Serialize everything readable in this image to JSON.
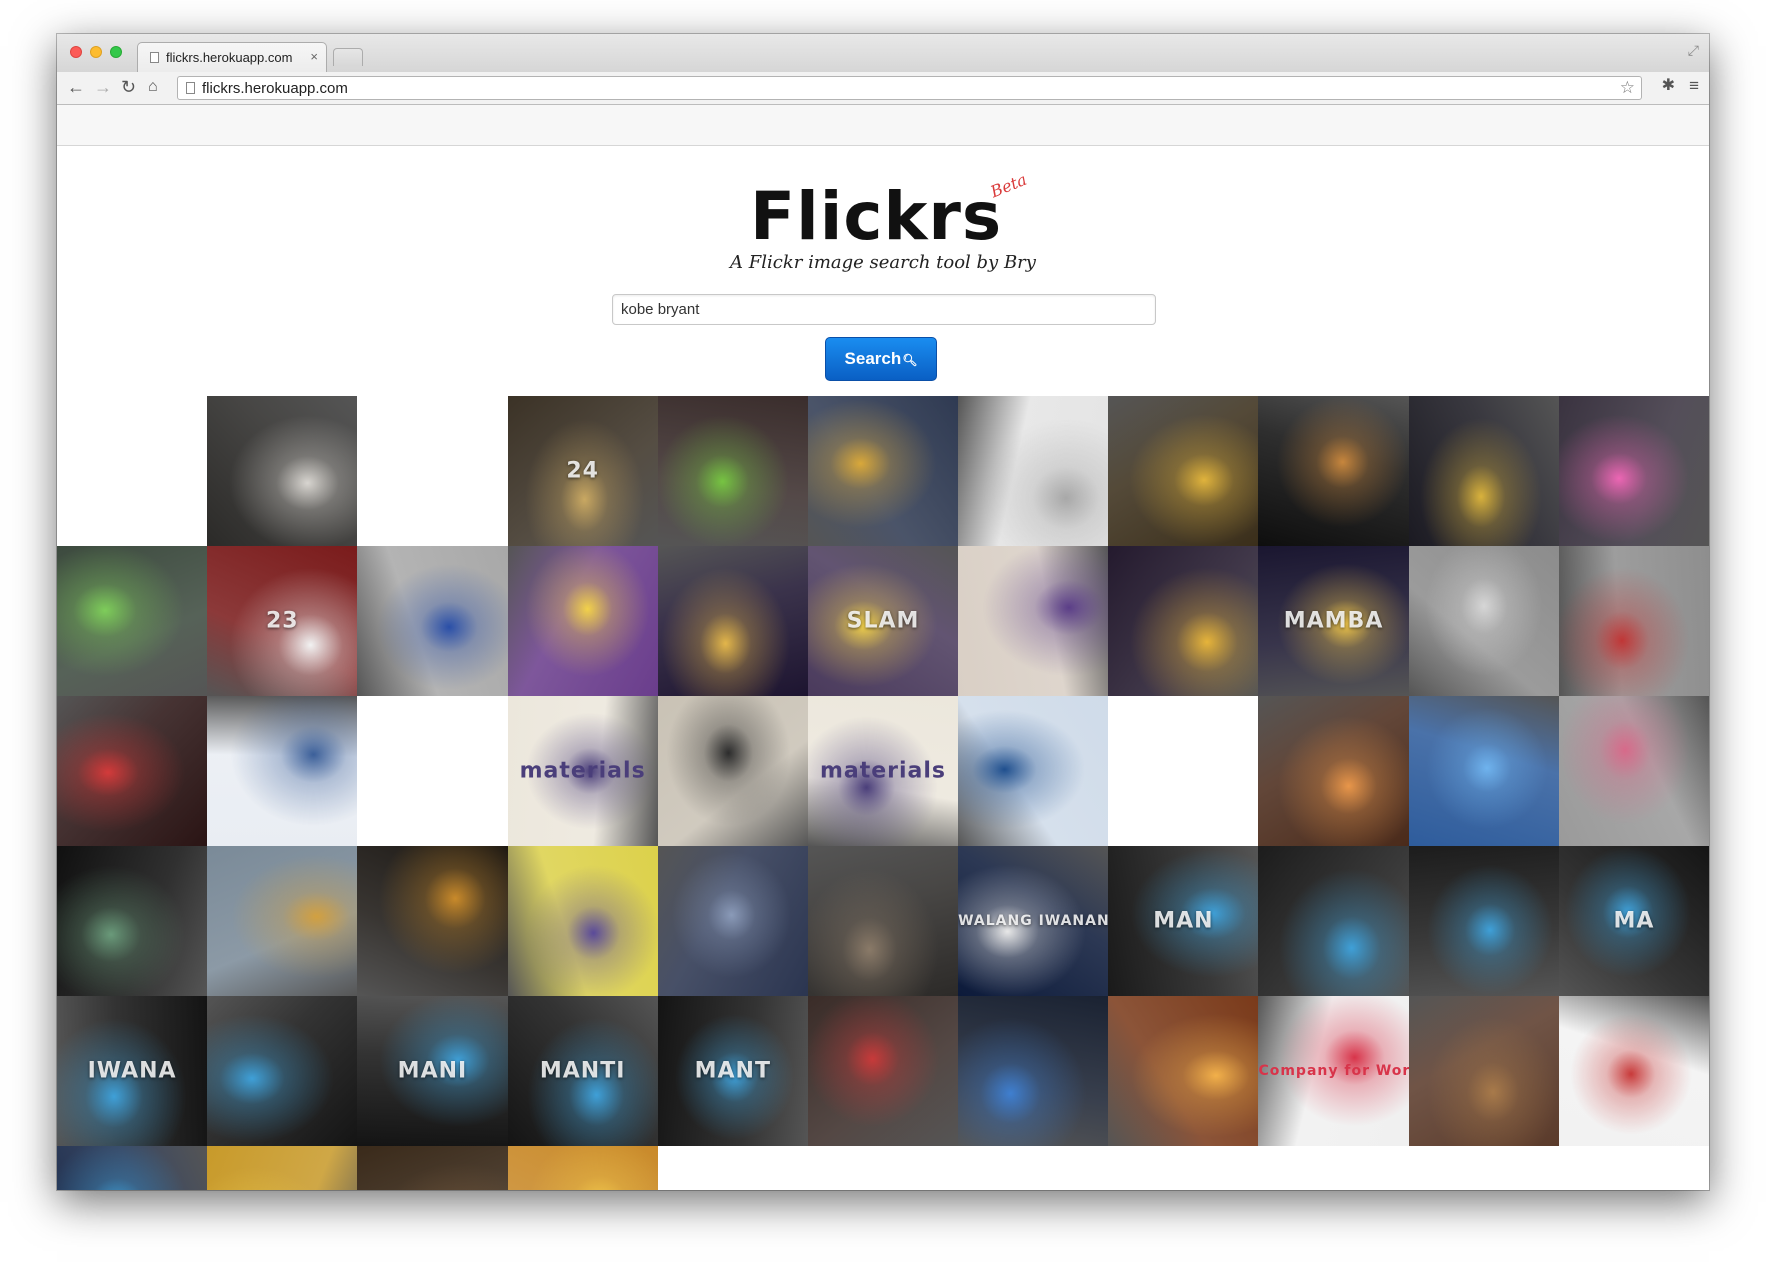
{
  "browser": {
    "tab_title": "flickrs.herokuapp.com",
    "tab_close": "×",
    "url": "flickrs.herokuapp.com",
    "icons": {
      "back": "back-arrow-icon",
      "forward": "forward-arrow-icon",
      "reload": "reload-icon",
      "home": "home-icon",
      "star": "star-icon",
      "extension": "extension-icon",
      "menu": "menu-icon"
    }
  },
  "app": {
    "logo": "Flickrs",
    "badge": "Beta",
    "tagline": "A Flickr image search tool by Bry",
    "search_value": "kobe bryant",
    "search_button": "Search"
  },
  "results": {
    "columns": 11,
    "tiles": [
      {
        "bg": "#f4f4f4",
        "fg": "#ddd",
        "text": ""
      },
      {
        "bg": "#2b2a28",
        "fg": "#d8d5d0",
        "text": ""
      },
      {
        "bg": "#f4f4f4",
        "fg": "#ddd",
        "text": ""
      },
      {
        "bg": "#3b3226",
        "fg": "#c9a862",
        "text": "24"
      },
      {
        "bg": "#3a2d2c",
        "fg": "#76c442",
        "text": ""
      },
      {
        "bg": "#2f3a52",
        "fg": "#d9a83a",
        "text": ""
      },
      {
        "bg": "#e4e4e4",
        "fg": "#a8a8a8",
        "text": ""
      },
      {
        "bg": "#3a2e1a",
        "fg": "#e0b33c",
        "text": ""
      },
      {
        "bg": "#0e0e0e",
        "fg": "#c7863d",
        "text": ""
      },
      {
        "bg": "#1b1a22",
        "fg": "#d9b23c",
        "text": ""
      },
      {
        "bg": "#3a3340",
        "fg": "#ec66b4",
        "text": ""
      },
      {
        "bg": "#3c4a3e",
        "fg": "#7ecd5a",
        "text": ""
      },
      {
        "bg": "#7a1b1b",
        "fg": "#f2f2f2",
        "text": "23"
      },
      {
        "bg": "#a8a8a8",
        "fg": "#2a4fa8",
        "text": ""
      },
      {
        "bg": "#6a3d8c",
        "fg": "#f2d14a",
        "text": ""
      },
      {
        "bg": "#1d1430",
        "fg": "#e3b64a",
        "text": ""
      },
      {
        "bg": "#4a3a5c",
        "fg": "#f2d14a",
        "text": "SLAM"
      },
      {
        "bg": "#d9cfc5",
        "fg": "#5b3e88",
        "text": ""
      },
      {
        "bg": "#241a2e",
        "fg": "#e6b43a",
        "text": ""
      },
      {
        "bg": "#1a1630",
        "fg": "#f2c84a",
        "text": "MAMBA"
      },
      {
        "bg": "#8c8c8c",
        "fg": "#d6d6d6",
        "text": ""
      },
      {
        "bg": "#8e8e8e",
        "fg": "#c03636",
        "text": ""
      },
      {
        "bg": "#2a1414",
        "fg": "#d33a3a",
        "text": ""
      },
      {
        "bg": "#e9edf3",
        "fg": "#3b5f99",
        "text": ""
      },
      {
        "bg": "#f5f5f5",
        "fg": "#333",
        "text": ""
      },
      {
        "bg": "#ece7dc",
        "fg": "#4a3e7a",
        "text": "materials"
      },
      {
        "bg": "#c9c2b5",
        "fg": "#2c2c2c",
        "text": ""
      },
      {
        "bg": "#ece7dc",
        "fg": "#4a3e7a",
        "text": "materials"
      },
      {
        "bg": "#cfdbe9",
        "fg": "#1f4f8e",
        "text": ""
      },
      {
        "bg": "#f2f2f2",
        "fg": "#555",
        "text": ""
      },
      {
        "bg": "#4a2a1a",
        "fg": "#e8964a",
        "text": ""
      },
      {
        "bg": "#2e5c9c",
        "fg": "#6fb3ee",
        "text": ""
      },
      {
        "bg": "#9a9a9a",
        "fg": "#d76a8a",
        "text": ""
      },
      {
        "bg": "#101010",
        "fg": "#6a9a7a",
        "text": ""
      },
      {
        "bg": "#7a8a98",
        "fg": "#d2a040",
        "text": ""
      },
      {
        "bg": "#1a1612",
        "fg": "#c98a2a",
        "text": ""
      },
      {
        "bg": "#dcd14a",
        "fg": "#5a4a9a",
        "text": ""
      },
      {
        "bg": "#2b3550",
        "fg": "#8a9ab8",
        "text": ""
      },
      {
        "bg": "#2c2a28",
        "fg": "#8a7a68",
        "text": ""
      },
      {
        "bg": "#0c1a3a",
        "fg": "#e8e8e8",
        "text": "WALANG IWANAN"
      },
      {
        "bg": "#1a1a1a",
        "fg": "#3fa0d8",
        "text": "MAN"
      },
      {
        "bg": "#1c1c1c",
        "fg": "#3fa0d8",
        "text": ""
      },
      {
        "bg": "#1c1c1c",
        "fg": "#3fa0d8",
        "text": ""
      },
      {
        "bg": "#151515",
        "fg": "#3fa0d8",
        "text": "MA"
      },
      {
        "bg": "#141414",
        "fg": "#3fa0d8",
        "text": "IWANA"
      },
      {
        "bg": "#141414",
        "fg": "#3fa0d8",
        "text": ""
      },
      {
        "bg": "#141414",
        "fg": "#3fa0d8",
        "text": "MANI"
      },
      {
        "bg": "#141414",
        "fg": "#3fa0d8",
        "text": "MANTI"
      },
      {
        "bg": "#141414",
        "fg": "#3fa0d8",
        "text": "MANT"
      },
      {
        "bg": "#3a2c28",
        "fg": "#c83a3a",
        "text": ""
      },
      {
        "bg": "#1a2232",
        "fg": "#3f7fd0",
        "text": ""
      },
      {
        "bg": "#7a3a1a",
        "fg": "#f2b04a",
        "text": ""
      },
      {
        "bg": "#f0f0f0",
        "fg": "#d8344a",
        "text": "Company for World"
      },
      {
        "bg": "#5a3a2a",
        "fg": "#a87a4a",
        "text": ""
      },
      {
        "bg": "#f2f2f2",
        "fg": "#c83a3a",
        "text": ""
      },
      {
        "bg": "#1a2a4a",
        "fg": "#3fa0d8",
        "text": ""
      },
      {
        "bg": "#c89a2a",
        "fg": "#f2d14a",
        "text": ""
      },
      {
        "bg": "#3a2a1a",
        "fg": "#7a5a3a",
        "text": ""
      },
      {
        "bg": "#c98a2a",
        "fg": "#f2c84a",
        "text": ""
      },
      {
        "bg": "#1a1a1a",
        "fg": "#555",
        "text": ""
      },
      {
        "bg": "#2a2a2a",
        "fg": "#666",
        "text": ""
      },
      {
        "bg": "#1e1e1e",
        "fg": "#888",
        "text": ""
      },
      {
        "bg": "#2a1a10",
        "fg": "#888",
        "text": ""
      },
      {
        "bg": "#1a1a1a",
        "fg": "#888",
        "text": ""
      },
      {
        "bg": "#202020",
        "fg": "#888",
        "text": ""
      },
      {
        "bg": "#2a2a2a",
        "fg": "#888",
        "text": ""
      }
    ]
  }
}
